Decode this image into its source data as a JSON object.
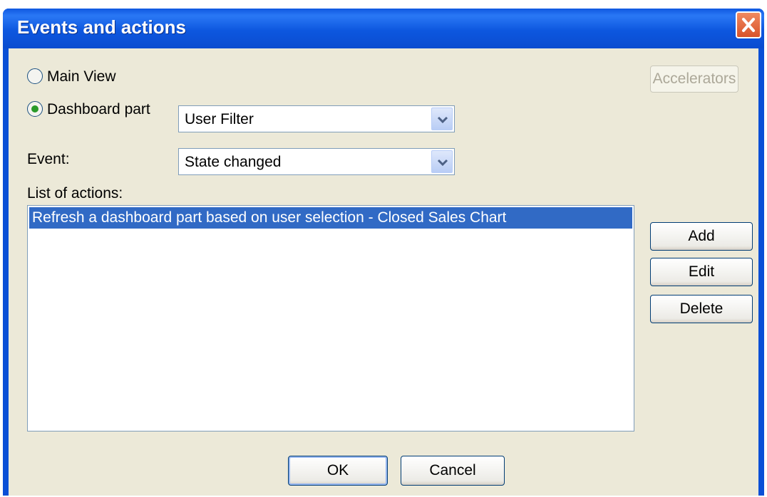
{
  "window": {
    "title": "Events and actions"
  },
  "source": {
    "main_view_label": "Main View",
    "dashboard_part_label": "Dashboard part",
    "selected": "Dashboard part",
    "dashboard_part_value": "User Filter"
  },
  "accelerators_label": "Accelerators",
  "event": {
    "label": "Event:",
    "value": "State changed"
  },
  "actions": {
    "label": "List of actions:",
    "items": [
      "Refresh a dashboard part based on user selection - Closed Sales Chart"
    ],
    "selected_index": 0
  },
  "side_buttons": {
    "add": "Add",
    "edit": "Edit",
    "delete": "Delete"
  },
  "footer": {
    "ok": "OK",
    "cancel": "Cancel"
  },
  "colors": {
    "titlebar": "#0a4fd6",
    "client_bg": "#ece9d8",
    "selection": "#316ac5",
    "close": "#d8532a"
  }
}
